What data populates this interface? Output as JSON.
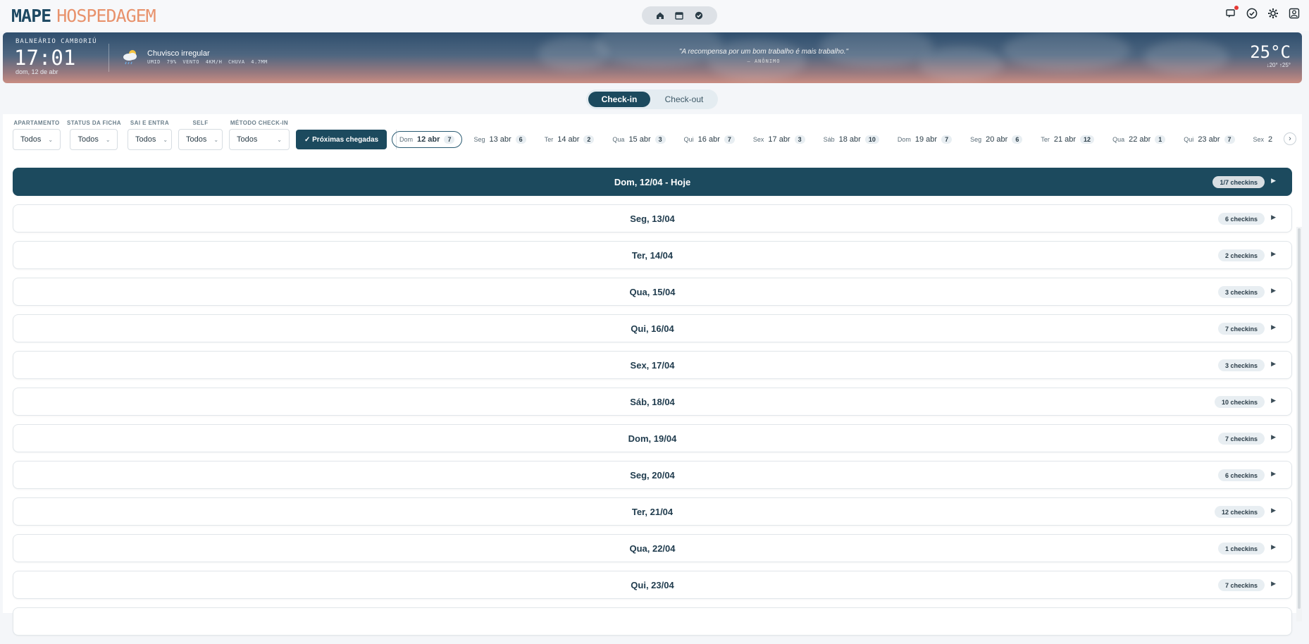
{
  "brand": {
    "part1": "MAPE",
    "part2": "HOSPEDAGEM"
  },
  "nav_icons": [
    "home-icon",
    "calendar-icon",
    "check-circle-icon"
  ],
  "tool_icons": [
    "notifications-icon",
    "check-badge-icon",
    "settings-icon",
    "profile-icon"
  ],
  "weather": {
    "city": "BALNEÁRIO CAMBORIÚ",
    "time": "17:01",
    "date": "dom, 12 de abr",
    "condition": "Chuvisco irregular",
    "stats": "UMID 79%   VENTO 4KM/H   CHUVA 4.7MM",
    "quote": "\"A recompensa por um bom trabalho é mais trabalho.\"",
    "author": "— ANÔNIMO",
    "temp": "25°C",
    "range": "↓20° ↑25°"
  },
  "toggle": {
    "checkin": "Check-in",
    "checkout": "Check-out"
  },
  "filters": {
    "apartamento": {
      "label": "APARTAMENTO",
      "value": "Todos"
    },
    "status": {
      "label": "STATUS DA FICHA",
      "value": "Todos"
    },
    "sai_entra": {
      "label": "SAI E ENTRA",
      "value": "Todos"
    },
    "self": {
      "label": "SELF",
      "value": "Todos"
    },
    "metodo": {
      "label": "MÉTODO CHECK-IN",
      "value": "Todos"
    },
    "proximas": "✓ Próximas chegadas"
  },
  "days": [
    {
      "wd": "Dom",
      "dt": "12 abr",
      "n": "7"
    },
    {
      "wd": "Seg",
      "dt": "13 abr",
      "n": "6"
    },
    {
      "wd": "Ter",
      "dt": "14 abr",
      "n": "2"
    },
    {
      "wd": "Qua",
      "dt": "15 abr",
      "n": "3"
    },
    {
      "wd": "Qui",
      "dt": "16 abr",
      "n": "7"
    },
    {
      "wd": "Sex",
      "dt": "17 abr",
      "n": "3"
    },
    {
      "wd": "Sáb",
      "dt": "18 abr",
      "n": "10"
    },
    {
      "wd": "Dom",
      "dt": "19 abr",
      "n": "7"
    },
    {
      "wd": "Seg",
      "dt": "20 abr",
      "n": "6"
    },
    {
      "wd": "Ter",
      "dt": "21 abr",
      "n": "12"
    },
    {
      "wd": "Qua",
      "dt": "22 abr",
      "n": "1"
    },
    {
      "wd": "Qui",
      "dt": "23 abr",
      "n": "7"
    },
    {
      "wd": "Sex",
      "dt": "2",
      "n": ""
    }
  ],
  "rows": [
    {
      "title": "Dom, 12/04 - Hoje",
      "count": "1/7 checkins"
    },
    {
      "title": "Seg, 13/04",
      "count": "6 checkins"
    },
    {
      "title": "Ter, 14/04",
      "count": "2 checkins"
    },
    {
      "title": "Qua, 15/04",
      "count": "3 checkins"
    },
    {
      "title": "Qui, 16/04",
      "count": "7 checkins"
    },
    {
      "title": "Sex, 17/04",
      "count": "3 checkins"
    },
    {
      "title": "Sáb, 18/04",
      "count": "10 checkins"
    },
    {
      "title": "Dom, 19/04",
      "count": "7 checkins"
    },
    {
      "title": "Seg, 20/04",
      "count": "6 checkins"
    },
    {
      "title": "Ter, 21/04",
      "count": "12 checkins"
    },
    {
      "title": "Qua, 22/04",
      "count": "1 checkins"
    },
    {
      "title": "Qui, 23/04",
      "count": "7 checkins"
    }
  ]
}
